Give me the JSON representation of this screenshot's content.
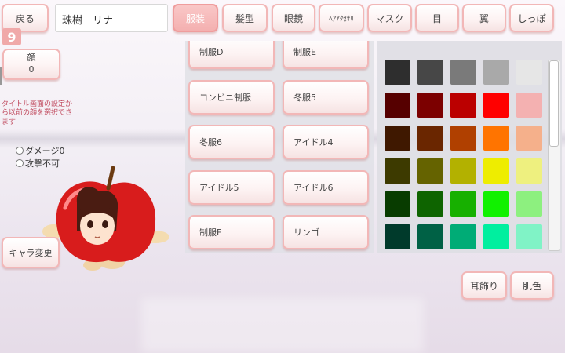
{
  "header": {
    "back_label": "戻る",
    "name_value": "珠樹　リナ",
    "tabs": [
      {
        "label": "服装",
        "active": true
      },
      {
        "label": "髪型",
        "active": false
      },
      {
        "label": "眼鏡",
        "active": false
      },
      {
        "label": "ﾍｱｱｸｾｻﾘ",
        "active": false
      },
      {
        "label": "マスク",
        "active": false
      },
      {
        "label": "目",
        "active": false
      },
      {
        "label": "翼",
        "active": false
      },
      {
        "label": "しっぽ",
        "active": false
      }
    ]
  },
  "left": {
    "badge": "9",
    "face_label": "顔",
    "face_value": "0",
    "note": "タイトル画面の設定から以前の顔を選択できます",
    "radio_damage": "ダメージ0",
    "radio_no_attack": "攻撃不可",
    "change_char_label": "キャラ変更"
  },
  "clothes": {
    "items": [
      "制服D",
      "制服E",
      "コンビニ制服",
      "冬服5",
      "冬服6",
      "アイドル4",
      "アイドル5",
      "アイドル6",
      "制服F",
      "リンゴ"
    ]
  },
  "palette": {
    "rows": [
      [
        "#2e2e2e",
        "#474747",
        "#7a7a7a",
        "#a9a9a9",
        "#e6e6e6"
      ],
      [
        "#560000",
        "#7c0000",
        "#bb0000",
        "#ff0000",
        "#f4b1b1"
      ],
      [
        "#3f1800",
        "#6a2600",
        "#b04000",
        "#ff7400",
        "#f5b08b"
      ],
      [
        "#3d3a00",
        "#656300",
        "#b3b100",
        "#eeed00",
        "#eef07f"
      ],
      [
        "#083c00",
        "#0e6400",
        "#17b000",
        "#11f100",
        "#8df07f"
      ],
      [
        "#003a2b",
        "#006145",
        "#00ac76",
        "#00ef9f",
        "#80f3c6"
      ]
    ]
  },
  "bottom_right": {
    "earring_label": "耳飾り",
    "skin_label": "肌色"
  },
  "colors": {
    "accent_border": "#f2b7b7",
    "active_tab": "#f4b0b0",
    "note_text": "#c04a5e"
  }
}
